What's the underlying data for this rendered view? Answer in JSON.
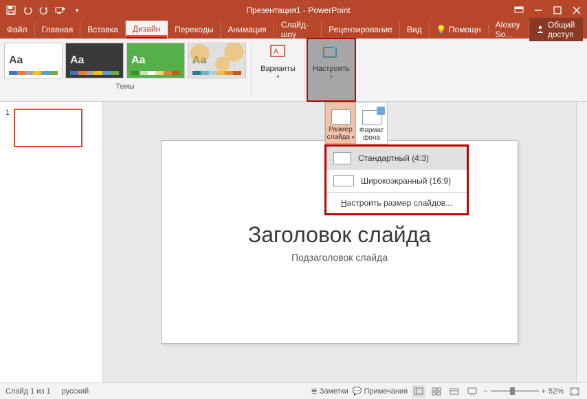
{
  "title": "Презентация1 - PowerPoint",
  "tabs": {
    "file": "Файл",
    "home": "Главная",
    "insert": "Вставка",
    "design": "Дизайн",
    "transitions": "Переходы",
    "animation": "Анимация",
    "slideshow": "Слайд-шоу",
    "review": "Рецензирование",
    "view": "Вид",
    "help": "Помощн",
    "user": "Alexey So...",
    "share": "Общий доступ"
  },
  "ribbon": {
    "themes_label": "Темы",
    "variants": "Варианты",
    "customize": "Настроить",
    "theme_bars": {
      "t1": [
        "#4472c4",
        "#ed7d31",
        "#a5a5a5",
        "#ffc000",
        "#5b9bd5",
        "#70ad47"
      ],
      "t2": [
        "#4472c4",
        "#ed7d31",
        "#a5a5a5",
        "#ffc000",
        "#5b9bd5",
        "#70ad47"
      ],
      "t3": [
        "#3b8f2e",
        "#c6e0b4",
        "#ffffff",
        "#f7d08a",
        "#e97c30",
        "#c55a11"
      ],
      "t4": [
        "#2e7a8f",
        "#6fb4c7",
        "#a3d2de",
        "#f4b74a",
        "#e68a2e",
        "#c55a11"
      ]
    }
  },
  "slidesize": {
    "size_label_l1": "Размер",
    "size_label_l2": "слайда",
    "format_label_l1": "Формат",
    "format_label_l2": "фона",
    "opt_std": "Стандартный (4:3)",
    "opt_wide": "Широкоэкранный (16:9)",
    "opt_custom_pre": "Н",
    "opt_custom_rest": "астроить размер слайдов..."
  },
  "slide": {
    "title_placeholder": "Заголовок слайда",
    "subtitle_placeholder": "Подзаголовок слайда",
    "thumb_number": "1"
  },
  "status": {
    "slide_counter": "Слайд 1 из 1",
    "language": "русский",
    "notes": "Заметки",
    "comments": "Примечания",
    "zoom": "52%",
    "zoom_minus": "−",
    "zoom_plus": "+"
  }
}
